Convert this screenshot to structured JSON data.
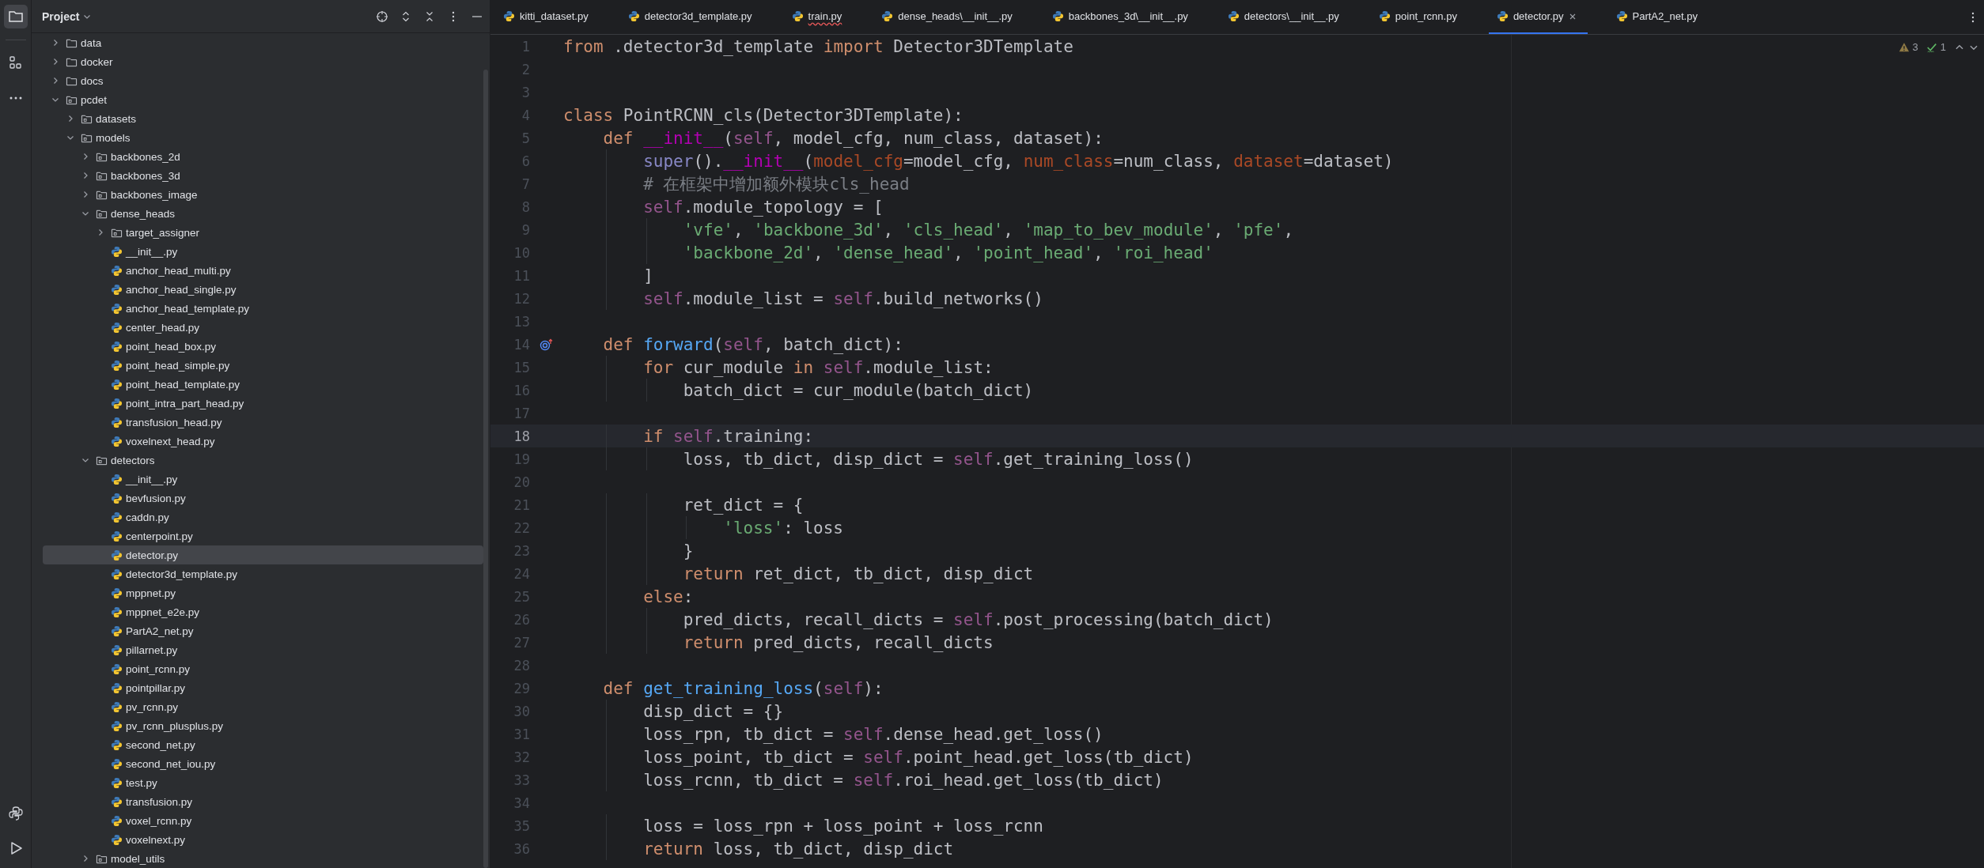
{
  "sidebar": {
    "title": "Project",
    "tree": [
      {
        "label": "data",
        "kind": "folder",
        "expanded": false,
        "selected": false
      },
      {
        "label": "docker",
        "kind": "folder",
        "expanded": false,
        "selected": false
      },
      {
        "label": "docs",
        "kind": "folder",
        "expanded": false,
        "selected": false
      },
      {
        "label": "pcdet",
        "kind": "package",
        "expanded": true,
        "selected": false,
        "children": [
          {
            "label": "datasets",
            "kind": "package",
            "expanded": false,
            "selected": false
          },
          {
            "label": "models",
            "kind": "package",
            "expanded": true,
            "selected": false,
            "children": [
              {
                "label": "backbones_2d",
                "kind": "package",
                "expanded": false,
                "selected": false
              },
              {
                "label": "backbones_3d",
                "kind": "package",
                "expanded": false,
                "selected": false
              },
              {
                "label": "backbones_image",
                "kind": "package",
                "expanded": false,
                "selected": false
              },
              {
                "label": "dense_heads",
                "kind": "package",
                "expanded": true,
                "selected": false,
                "children": [
                  {
                    "label": "target_assigner",
                    "kind": "package",
                    "expanded": false,
                    "selected": false
                  },
                  {
                    "label": "__init__.py",
                    "kind": "python",
                    "selected": false
                  },
                  {
                    "label": "anchor_head_multi.py",
                    "kind": "python",
                    "selected": false
                  },
                  {
                    "label": "anchor_head_single.py",
                    "kind": "python",
                    "selected": false
                  },
                  {
                    "label": "anchor_head_template.py",
                    "kind": "python",
                    "selected": false
                  },
                  {
                    "label": "center_head.py",
                    "kind": "python",
                    "selected": false
                  },
                  {
                    "label": "point_head_box.py",
                    "kind": "python",
                    "selected": false
                  },
                  {
                    "label": "point_head_simple.py",
                    "kind": "python",
                    "selected": false
                  },
                  {
                    "label": "point_head_template.py",
                    "kind": "python",
                    "selected": false
                  },
                  {
                    "label": "point_intra_part_head.py",
                    "kind": "python",
                    "selected": false
                  },
                  {
                    "label": "transfusion_head.py",
                    "kind": "python",
                    "selected": false
                  },
                  {
                    "label": "voxelnext_head.py",
                    "kind": "python",
                    "selected": false
                  }
                ]
              },
              {
                "label": "detectors",
                "kind": "package",
                "expanded": true,
                "selected": false,
                "children": [
                  {
                    "label": "__init__.py",
                    "kind": "python",
                    "selected": false
                  },
                  {
                    "label": "bevfusion.py",
                    "kind": "python",
                    "selected": false
                  },
                  {
                    "label": "caddn.py",
                    "kind": "python",
                    "selected": false
                  },
                  {
                    "label": "centerpoint.py",
                    "kind": "python",
                    "selected": false
                  },
                  {
                    "label": "detector.py",
                    "kind": "python",
                    "selected": true
                  },
                  {
                    "label": "detector3d_template.py",
                    "kind": "python",
                    "selected": false
                  },
                  {
                    "label": "mppnet.py",
                    "kind": "python",
                    "selected": false
                  },
                  {
                    "label": "mppnet_e2e.py",
                    "kind": "python",
                    "selected": false
                  },
                  {
                    "label": "PartA2_net.py",
                    "kind": "python",
                    "selected": false
                  },
                  {
                    "label": "pillarnet.py",
                    "kind": "python",
                    "selected": false
                  },
                  {
                    "label": "point_rcnn.py",
                    "kind": "python",
                    "selected": false
                  },
                  {
                    "label": "pointpillar.py",
                    "kind": "python",
                    "selected": false
                  },
                  {
                    "label": "pv_rcnn.py",
                    "kind": "python",
                    "selected": false
                  },
                  {
                    "label": "pv_rcnn_plusplus.py",
                    "kind": "python",
                    "selected": false
                  },
                  {
                    "label": "second_net.py",
                    "kind": "python",
                    "selected": false
                  },
                  {
                    "label": "second_net_iou.py",
                    "kind": "python",
                    "selected": false
                  },
                  {
                    "label": "test.py",
                    "kind": "python",
                    "selected": false
                  },
                  {
                    "label": "transfusion.py",
                    "kind": "python",
                    "selected": false
                  },
                  {
                    "label": "voxel_rcnn.py",
                    "kind": "python",
                    "selected": false
                  },
                  {
                    "label": "voxelnext.py",
                    "kind": "python",
                    "selected": false
                  }
                ]
              },
              {
                "label": "model_utils",
                "kind": "package",
                "expanded": false,
                "selected": false
              }
            ]
          }
        ]
      }
    ]
  },
  "tabs": [
    {
      "label": "kitti_dataset.py",
      "selected": false,
      "error": false
    },
    {
      "label": "detector3d_template.py",
      "selected": false,
      "error": false
    },
    {
      "label": "train.py",
      "selected": false,
      "error": true
    },
    {
      "label": "dense_heads\\__init__.py",
      "selected": false,
      "error": false
    },
    {
      "label": "backbones_3d\\__init__.py",
      "selected": false,
      "error": false
    },
    {
      "label": "detectors\\__init__.py",
      "selected": false,
      "error": false
    },
    {
      "label": "point_rcnn.py",
      "selected": false,
      "error": false
    },
    {
      "label": "detector.py",
      "selected": true,
      "error": false
    },
    {
      "label": "PartA2_net.py",
      "selected": false,
      "error": false
    }
  ],
  "inspections": {
    "warnings": "3",
    "weak_warnings": "1"
  },
  "editor": {
    "lines": [
      {
        "number": "1",
        "current": false,
        "tokens": [
          {
            "kind": "kw",
            "text": "from"
          },
          {
            "kind": "plain",
            "text": " .detector3d_template "
          },
          {
            "kind": "kw",
            "text": "import"
          },
          {
            "kind": "plain",
            "text": " Detector3DTemplate"
          }
        ]
      },
      {
        "number": "2",
        "current": false
      },
      {
        "number": "3",
        "current": false
      },
      {
        "number": "4",
        "current": false,
        "tokens": [
          {
            "kind": "kw",
            "text": "class"
          },
          {
            "kind": "plain",
            "text": " PointRCNN_cls(Detector3DTemplate):"
          }
        ]
      },
      {
        "number": "5",
        "current": false,
        "tokens": [
          {
            "kind": "kw",
            "text": "    def"
          },
          {
            "kind": "magic",
            "text": " __init__"
          },
          {
            "kind": "plain",
            "text": "("
          },
          {
            "kind": "self",
            "text": "self"
          },
          {
            "kind": "plain",
            "text": ", model_cfg, num_class, dataset):"
          }
        ]
      },
      {
        "number": "6",
        "current": false,
        "tokens": [
          {
            "kind": "builtin",
            "text": "        super"
          },
          {
            "kind": "plain",
            "text": "()."
          },
          {
            "kind": "magic",
            "text": "__init__"
          },
          {
            "kind": "plain",
            "text": "("
          },
          {
            "kind": "param",
            "text": "model_cfg"
          },
          {
            "kind": "plain",
            "text": "=model_cfg, "
          },
          {
            "kind": "param",
            "text": "num_class"
          },
          {
            "kind": "plain",
            "text": "=num_class, "
          },
          {
            "kind": "param",
            "text": "dataset"
          },
          {
            "kind": "plain",
            "text": "=dataset)"
          }
        ]
      },
      {
        "number": "7",
        "current": false,
        "tokens": [
          {
            "kind": "comment",
            "text": "        # 在框架中增加额外模块cls_head"
          }
        ]
      },
      {
        "number": "8",
        "current": false,
        "tokens": [
          {
            "kind": "self",
            "text": "        self"
          },
          {
            "kind": "plain",
            "text": ".module_topology = ["
          }
        ]
      },
      {
        "number": "9",
        "current": false,
        "tokens": [
          {
            "kind": "str",
            "text": "            'vfe'"
          },
          {
            "kind": "plain",
            "text": ", "
          },
          {
            "kind": "str",
            "text": "'backbone_3d'"
          },
          {
            "kind": "plain",
            "text": ", "
          },
          {
            "kind": "str",
            "text": "'cls_head'"
          },
          {
            "kind": "plain",
            "text": ", "
          },
          {
            "kind": "str",
            "text": "'map_to_bev_module'"
          },
          {
            "kind": "plain",
            "text": ", "
          },
          {
            "kind": "str",
            "text": "'pfe'"
          },
          {
            "kind": "plain",
            "text": ","
          }
        ]
      },
      {
        "number": "10",
        "current": false,
        "tokens": [
          {
            "kind": "str",
            "text": "            'backbone_2d'"
          },
          {
            "kind": "plain",
            "text": ", "
          },
          {
            "kind": "str",
            "text": "'dense_head'"
          },
          {
            "kind": "plain",
            "text": ", "
          },
          {
            "kind": "str",
            "text": "'point_head'"
          },
          {
            "kind": "plain",
            "text": ", "
          },
          {
            "kind": "str",
            "text": "'roi_head'"
          }
        ]
      },
      {
        "number": "11",
        "current": false,
        "tokens": [
          {
            "kind": "plain",
            "text": "        ]"
          }
        ]
      },
      {
        "number": "12",
        "current": false,
        "tokens": [
          {
            "kind": "self",
            "text": "        self"
          },
          {
            "kind": "plain",
            "text": ".module_list = "
          },
          {
            "kind": "self",
            "text": "self"
          },
          {
            "kind": "plain",
            "text": ".build_networks()"
          }
        ]
      },
      {
        "number": "13",
        "current": false
      },
      {
        "number": "14",
        "current": false,
        "overrides": true,
        "tokens": [
          {
            "kind": "kw",
            "text": "    def"
          },
          {
            "kind": "fn",
            "text": " forward"
          },
          {
            "kind": "plain",
            "text": "("
          },
          {
            "kind": "self",
            "text": "self"
          },
          {
            "kind": "plain",
            "text": ", batch_dict):"
          }
        ]
      },
      {
        "number": "15",
        "current": false,
        "tokens": [
          {
            "kind": "kw",
            "text": "        for"
          },
          {
            "kind": "plain",
            "text": " cur_module "
          },
          {
            "kind": "kw",
            "text": "in"
          },
          {
            "kind": "self",
            "text": " self"
          },
          {
            "kind": "plain",
            "text": ".module_list:"
          }
        ]
      },
      {
        "number": "16",
        "current": false,
        "tokens": [
          {
            "kind": "plain",
            "text": "            batch_dict = cur_module(batch_dict)"
          }
        ]
      },
      {
        "number": "17",
        "current": false
      },
      {
        "number": "18",
        "current": true,
        "tokens": [
          {
            "kind": "kw",
            "text": "        if"
          },
          {
            "kind": "self",
            "text": " self"
          },
          {
            "kind": "plain",
            "text": ".training:"
          }
        ]
      },
      {
        "number": "19",
        "current": false,
        "tokens": [
          {
            "kind": "plain",
            "text": "            loss, tb_dict, disp_dict = "
          },
          {
            "kind": "self",
            "text": "self"
          },
          {
            "kind": "plain",
            "text": ".get_training_loss()"
          }
        ]
      },
      {
        "number": "20",
        "current": false
      },
      {
        "number": "21",
        "current": false,
        "tokens": [
          {
            "kind": "plain",
            "text": "            ret_dict = {"
          }
        ]
      },
      {
        "number": "22",
        "current": false,
        "tokens": [
          {
            "kind": "str",
            "text": "                'loss'"
          },
          {
            "kind": "plain",
            "text": ": loss"
          }
        ]
      },
      {
        "number": "23",
        "current": false,
        "tokens": [
          {
            "kind": "plain",
            "text": "            }"
          }
        ]
      },
      {
        "number": "24",
        "current": false,
        "tokens": [
          {
            "kind": "kw",
            "text": "            return"
          },
          {
            "kind": "plain",
            "text": " ret_dict, tb_dict, disp_dict"
          }
        ]
      },
      {
        "number": "25",
        "current": false,
        "tokens": [
          {
            "kind": "kw",
            "text": "        else"
          },
          {
            "kind": "plain",
            "text": ":"
          }
        ]
      },
      {
        "number": "26",
        "current": false,
        "tokens": [
          {
            "kind": "plain",
            "text": "            pred_dicts, recall_dicts = "
          },
          {
            "kind": "self",
            "text": "self"
          },
          {
            "kind": "plain",
            "text": ".post_processing(batch_dict)"
          }
        ]
      },
      {
        "number": "27",
        "current": false,
        "tokens": [
          {
            "kind": "kw",
            "text": "            return"
          },
          {
            "kind": "plain",
            "text": " pred_dicts, recall_dicts"
          }
        ]
      },
      {
        "number": "28",
        "current": false
      },
      {
        "number": "29",
        "current": false,
        "tokens": [
          {
            "kind": "kw",
            "text": "    def"
          },
          {
            "kind": "fn",
            "text": " get_training_loss"
          },
          {
            "kind": "plain",
            "text": "("
          },
          {
            "kind": "self",
            "text": "self"
          },
          {
            "kind": "plain",
            "text": "):"
          }
        ]
      },
      {
        "number": "30",
        "current": false,
        "tokens": [
          {
            "kind": "plain",
            "text": "        disp_dict = {}"
          }
        ]
      },
      {
        "number": "31",
        "current": false,
        "tokens": [
          {
            "kind": "plain",
            "text": "        loss_rpn, tb_dict = "
          },
          {
            "kind": "self",
            "text": "self"
          },
          {
            "kind": "plain",
            "text": ".dense_head.get_loss()"
          }
        ]
      },
      {
        "number": "32",
        "current": false,
        "tokens": [
          {
            "kind": "plain",
            "text": "        loss_point, tb_dict = "
          },
          {
            "kind": "self",
            "text": "self"
          },
          {
            "kind": "plain",
            "text": ".point_head.get_loss(tb_dict)"
          }
        ]
      },
      {
        "number": "33",
        "current": false,
        "tokens": [
          {
            "kind": "plain",
            "text": "        loss_rcnn, tb_dict = "
          },
          {
            "kind": "self",
            "text": "self"
          },
          {
            "kind": "plain",
            "text": ".roi_head.get_loss(tb_dict)"
          }
        ]
      },
      {
        "number": "34",
        "current": false
      },
      {
        "number": "35",
        "current": false,
        "tokens": [
          {
            "kind": "plain",
            "text": "        loss = loss_rpn + loss_point + loss_rcnn"
          }
        ]
      },
      {
        "number": "36",
        "current": false,
        "tokens": [
          {
            "kind": "kw",
            "text": "        return"
          },
          {
            "kind": "plain",
            "text": " loss, tb_dict, disp_dict"
          }
        ]
      }
    ]
  }
}
